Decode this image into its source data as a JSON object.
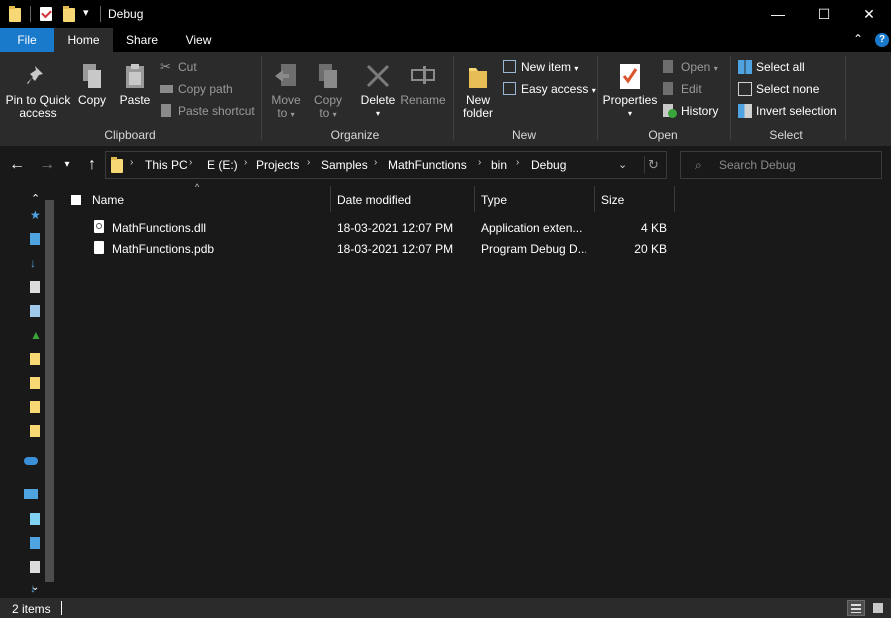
{
  "window": {
    "title": "Debug",
    "minimize_glyph": "—",
    "maximize_glyph": "☐",
    "close_glyph": "✕"
  },
  "tabs": {
    "file": "File",
    "home": "Home",
    "share": "Share",
    "view": "View"
  },
  "ribbon": {
    "clipboard": {
      "label": "Clipboard",
      "pin_line1": "Pin to Quick",
      "pin_line2": "access",
      "copy": "Copy",
      "paste": "Paste",
      "cut": "Cut",
      "copy_path": "Copy path",
      "paste_shortcut": "Paste shortcut"
    },
    "organize": {
      "label": "Organize",
      "move_line1": "Move",
      "move_line2": "to",
      "copy_line1": "Copy",
      "copy_line2": "to",
      "delete": "Delete",
      "rename": "Rename"
    },
    "new": {
      "label": "New",
      "new_folder_line1": "New",
      "new_folder_line2": "folder",
      "new_item": "New item",
      "easy_access": "Easy access"
    },
    "open": {
      "label": "Open",
      "properties": "Properties",
      "open": "Open",
      "edit": "Edit",
      "history": "History"
    },
    "select": {
      "label": "Select",
      "select_all": "Select all",
      "select_none": "Select none",
      "invert_selection": "Invert selection"
    }
  },
  "address": {
    "crumbs": [
      "This PC",
      "E (E:)",
      "Projects",
      "Samples",
      "MathFunctions",
      "bin",
      "Debug"
    ]
  },
  "search": {
    "placeholder": "Search Debug"
  },
  "columns": {
    "name": "Name",
    "date_modified": "Date modified",
    "type": "Type",
    "size": "Size"
  },
  "files": [
    {
      "name": "MathFunctions.dll",
      "date": "18-03-2021 12:07 PM",
      "type": "Application exten...",
      "size": "4 KB",
      "icon": "dll-file-icon"
    },
    {
      "name": "MathFunctions.pdb",
      "date": "18-03-2021 12:07 PM",
      "type": "Program Debug D...",
      "size": "20 KB",
      "icon": "blank-file-icon"
    }
  ],
  "status": {
    "item_count": "2 items"
  },
  "colors": {
    "accent": "#1979ca",
    "background": "#191919",
    "ribbon": "#2b2b2b",
    "folder": "#f8d775"
  }
}
